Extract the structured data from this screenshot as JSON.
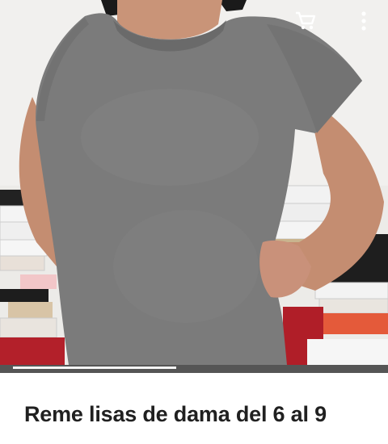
{
  "product": {
    "title": "Reme lisas de dama del 6 al 9",
    "image_alt": "Mujer con remera lisa gris de manga corta"
  },
  "gallery": {
    "progress": 0.45
  },
  "toolbar": {
    "cart_icon": "shopping-cart-icon",
    "menu_icon": "more-vertical-icon"
  },
  "colors": {
    "shirt": "#7c7c7c",
    "progress_track": "#555555",
    "progress_fill": "#f4f4f4",
    "title_text": "#202020"
  }
}
